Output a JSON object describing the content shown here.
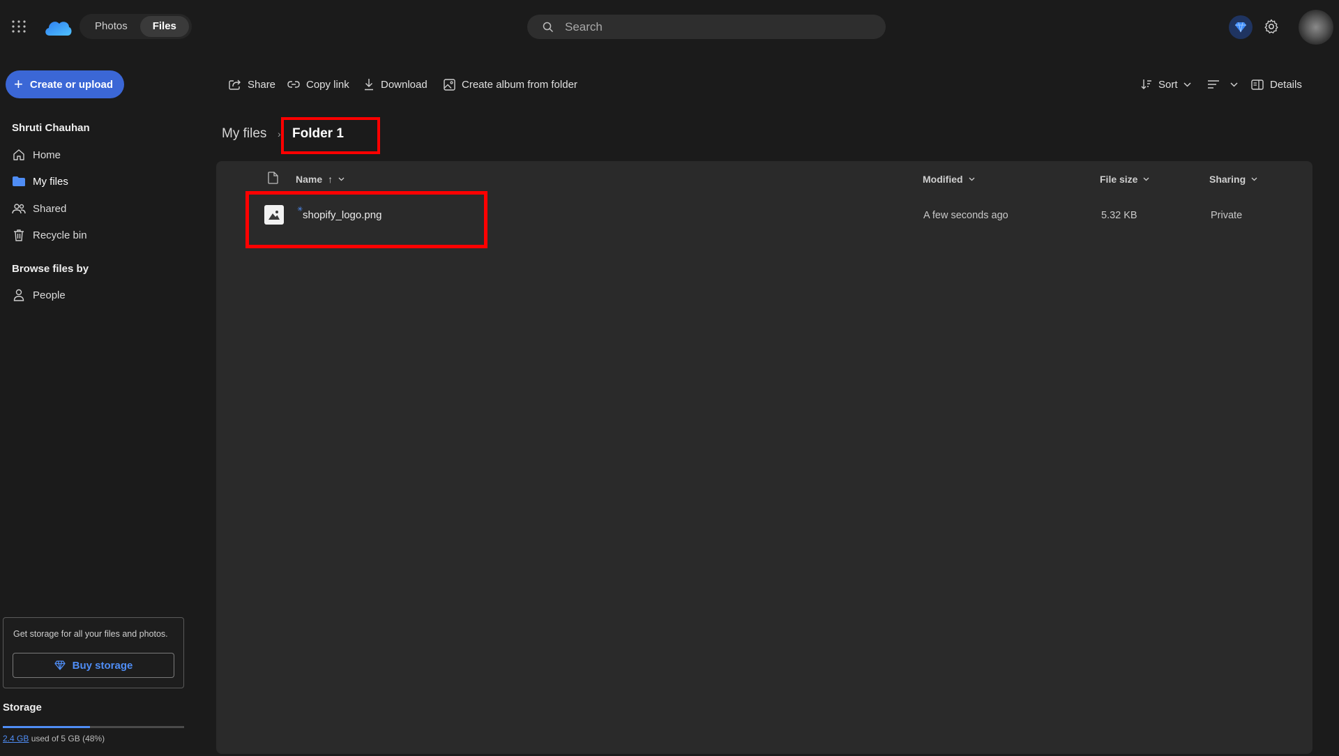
{
  "topbar": {
    "tabs": [
      {
        "label": "Photos",
        "active": false
      },
      {
        "label": "Files",
        "active": true
      }
    ],
    "search_placeholder": "Search",
    "icons": [
      "app-launcher-icon",
      "onedrive-logo",
      "search-icon",
      "premium-diamond-icon",
      "settings-gear-icon",
      "user-avatar"
    ]
  },
  "create_button": {
    "label": "Create or upload"
  },
  "sidebar": {
    "user_name": "Shruti Chauhan",
    "items": [
      {
        "label": "Home",
        "icon": "home-icon"
      },
      {
        "label": "My files",
        "icon": "folder-icon",
        "selected": true
      },
      {
        "label": "Shared",
        "icon": "shared-people-icon"
      },
      {
        "label": "Recycle bin",
        "icon": "trash-icon"
      }
    ],
    "browse_heading": "Browse files by",
    "browse_items": [
      {
        "label": "People",
        "icon": "person-icon"
      }
    ]
  },
  "promo": {
    "text": "Get storage for all your files and photos.",
    "button_label": "Buy storage"
  },
  "storage": {
    "title": "Storage",
    "used": "2.4 GB",
    "rest": " used of 5 GB (48%)",
    "fraction_used": 0.48
  },
  "commands": {
    "share": "Share",
    "copy_link": "Copy link",
    "download": "Download",
    "create_album": "Create album from folder",
    "sort": "Sort",
    "details": "Details"
  },
  "breadcrumb": {
    "root": "My files",
    "separator": "›",
    "current": "Folder 1"
  },
  "table": {
    "columns": {
      "name": "Name",
      "name_sort_indicator": "↑",
      "modified": "Modified",
      "file_size": "File size",
      "sharing": "Sharing"
    },
    "rows": [
      {
        "name": "shopify_logo.png",
        "modified": "A few seconds ago",
        "file_size": "5.32 KB",
        "sharing": "Private",
        "icon": "image-file-icon"
      }
    ]
  },
  "colors": {
    "background": "#1b1b1b",
    "panel": "#2a2a2a",
    "accent_blue": "#3b67d6",
    "link_blue": "#4f8df5",
    "highlight_red": "#ff0000"
  }
}
